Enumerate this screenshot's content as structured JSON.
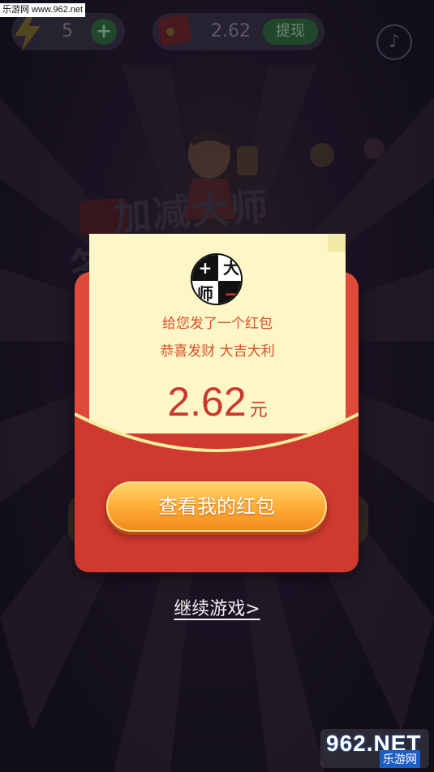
{
  "watermark_top": "乐游网 www.962.net",
  "top_bar": {
    "energy_count": "5",
    "plus_label": "+",
    "money_amount": "2.62",
    "withdraw_label": "提现",
    "music_icon": "♪"
  },
  "background": {
    "title_line1": "加减大师",
    "title_line2": "答         包"
  },
  "popup": {
    "logo": [
      "+",
      "大",
      "师",
      "−"
    ],
    "message_line1": "给您发了一个红包",
    "message_line2": "恭喜发财 大吉大利",
    "amount": "2.62",
    "amount_unit": "元",
    "view_button": "查看我的红包"
  },
  "continue_link": "继续游戏>",
  "watermark_bottom": {
    "main": "962.NET",
    "sub": "乐游网"
  },
  "colors": {
    "envelope_red": "#d0392f",
    "letter_cream": "#fdf7c7",
    "button_orange": "#f7a02e",
    "text_red": "#c9392c"
  },
  "icons": [
    "lightning-icon",
    "plus-icon",
    "red-envelope-icon",
    "music-note-icon",
    "chevron-right-icon"
  ]
}
